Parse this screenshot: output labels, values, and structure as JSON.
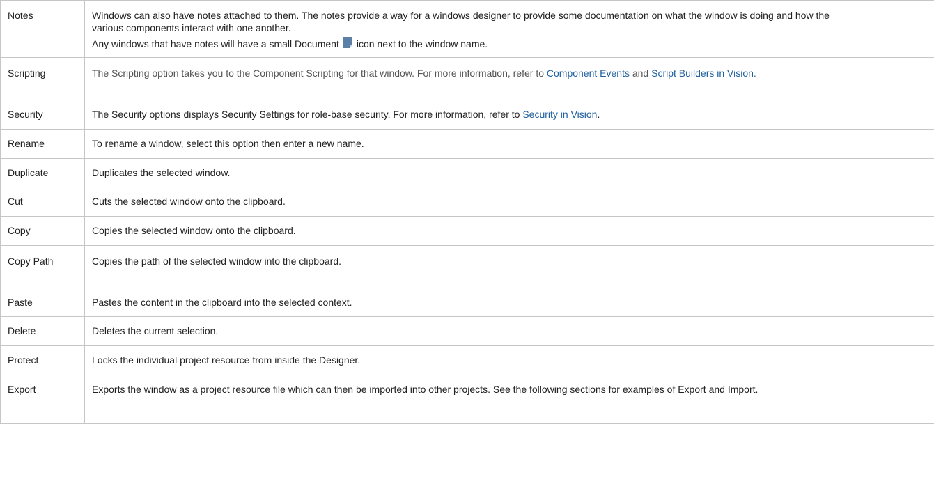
{
  "rows": [
    {
      "name": "Notes",
      "desc_line1": "Windows can also have notes attached to them. The notes provide a way for a windows designer to provide some documentation on what the window is doing and how the various components interact with one another.",
      "desc_line2_before": "Any windows that have notes will have a small Document",
      "desc_line2_after": "icon next to the window name.",
      "icon": "document-note-icon"
    },
    {
      "name": "Scripting",
      "desc_before": "The Scripting option takes you to the Component Scripting for that window. For more information, refer to",
      "link1": "Component Events",
      "desc_mid": "and",
      "link2": "Script Builders in Vision",
      "desc_after": "."
    },
    {
      "name": "Security",
      "desc_before": "The Security options displays Security Settings for role-base security. For more information, refer to",
      "link1": "Security in Vision",
      "desc_after": "."
    },
    {
      "name": "Rename",
      "desc": "To rename a window, select this option then enter a new name."
    },
    {
      "name": "Duplicate",
      "desc": "Duplicates the selected window."
    },
    {
      "name": "Cut",
      "desc": "Cuts the selected window onto the clipboard."
    },
    {
      "name": "Copy",
      "desc": "Copies the selected window onto the clipboard."
    },
    {
      "name": "Copy Path",
      "desc": "Copies the path of the selected window into the clipboard."
    },
    {
      "name": "Paste",
      "desc": "Pastes the content in the clipboard into the selected context."
    },
    {
      "name": "Delete",
      "desc": "Deletes the current selection."
    },
    {
      "name": "Protect",
      "desc": "Locks the individual project resource from inside the Designer."
    },
    {
      "name": "Export",
      "desc": "Exports the window as a project resource file which can then be imported into other projects. See the following sections for examples of Export and Import."
    }
  ]
}
